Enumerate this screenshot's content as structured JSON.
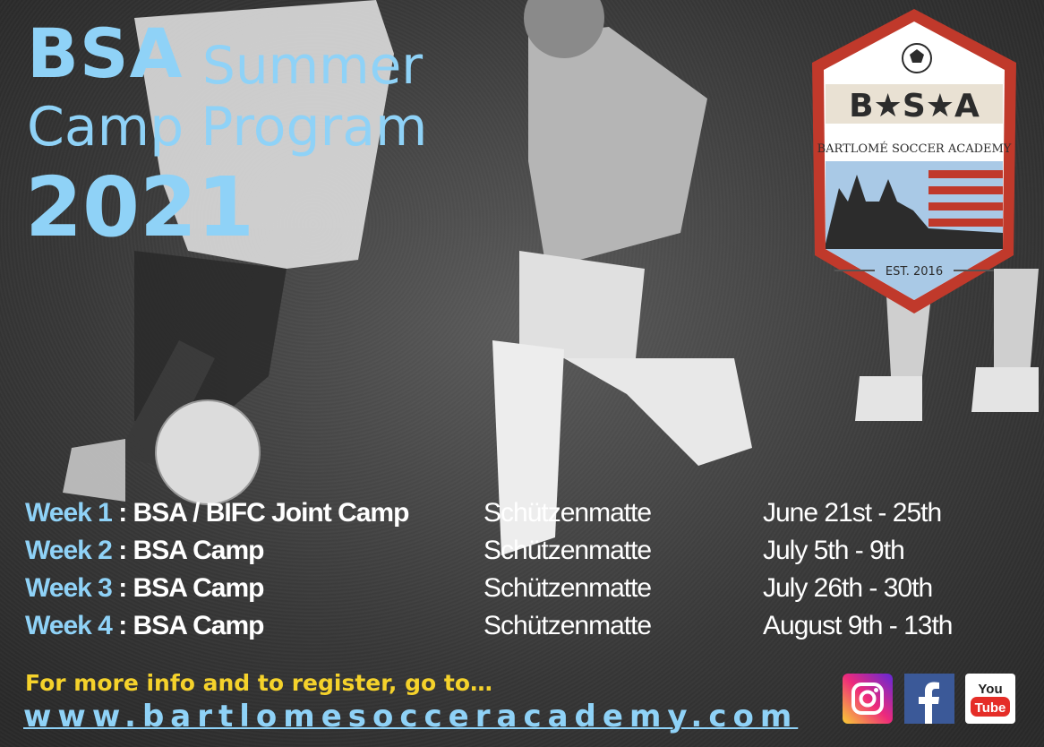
{
  "title": {
    "line1_bold": "BSA",
    "line1_rest": "Summer",
    "line2": "Camp Program",
    "year": "2021"
  },
  "logo": {
    "letters": "B★S★A",
    "name": "BARTLOMÉ SOCCER ACADEMY",
    "established": "EST. 2016"
  },
  "schedule": [
    {
      "week": "Week 1",
      "camp": "BSA / BIFC Joint Camp",
      "location": "Schützenmatte",
      "dates": "June 21st - 25th"
    },
    {
      "week": "Week 2",
      "camp": "BSA Camp",
      "location": "Schützenmatte",
      "dates": "July 5th - 9th"
    },
    {
      "week": "Week 3",
      "camp": "BSA Camp",
      "location": "Schützenmatte",
      "dates": "July 26th - 30th"
    },
    {
      "week": "Week 4",
      "camp": "BSA Camp",
      "location": "Schützenmatte",
      "dates": "August 9th - 13th"
    }
  ],
  "footer": {
    "info_text": "For more info and to register, go to…",
    "url": "www.bartlomesocceracademy.com"
  },
  "social": {
    "youtube_line1": "You",
    "youtube_line2": "Tube"
  },
  "colors": {
    "title_blue": "#8fd2f7",
    "info_yellow": "#f5d22b",
    "shield_red": "#c0392b",
    "shield_blue": "#a9c9e6"
  }
}
